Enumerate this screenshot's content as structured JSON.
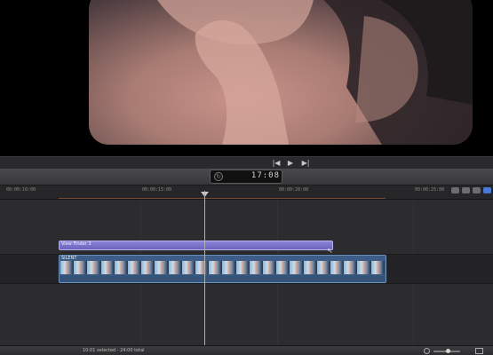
{
  "transport": {
    "prev_icon": "skip-back-icon",
    "play_icon": "play-icon",
    "next_icon": "skip-forward-icon"
  },
  "timecode": {
    "value": "17:08"
  },
  "ruler": {
    "ticks": [
      "00:00:10:00",
      "00:00:15:00",
      "00:00:20:00",
      "00:00:25:00"
    ]
  },
  "timeline": {
    "title_clip": "View Finder 3",
    "video_clip": "SILENT"
  },
  "status": {
    "text": "10:01 selected - 24:00 total"
  },
  "colors": {
    "title_clip": "#7b74cf",
    "video_clip": "#3e5d86",
    "playhead": "#b0b0b0"
  }
}
